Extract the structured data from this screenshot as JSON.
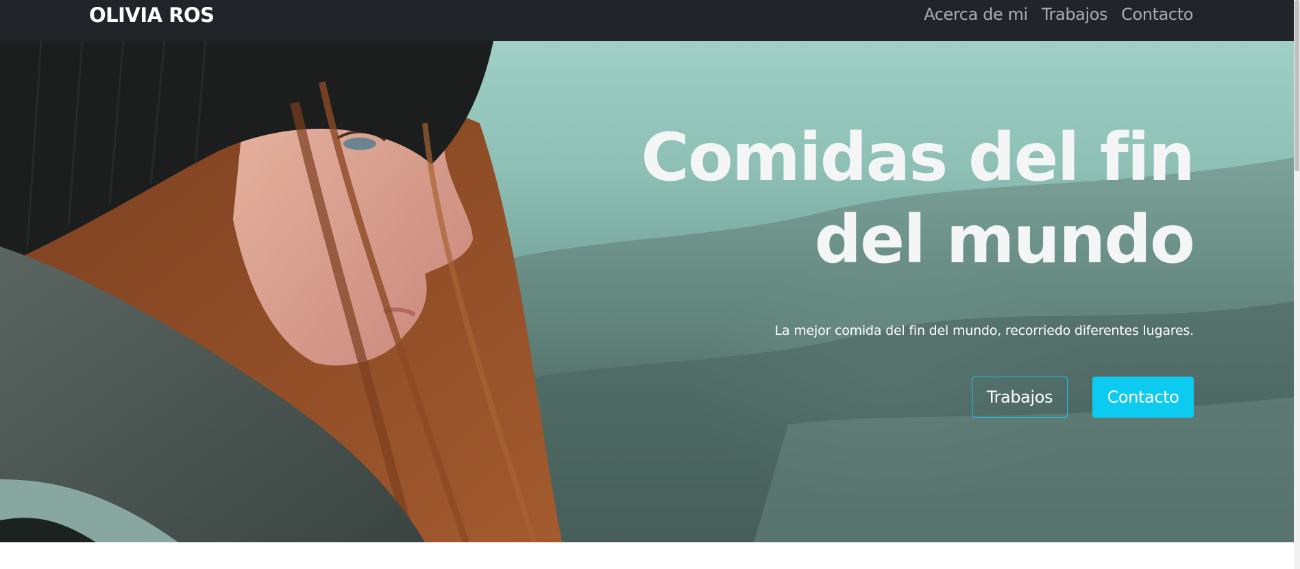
{
  "navbar": {
    "brand": "OLIVIA ROS",
    "links": [
      "Acerca de mi",
      "Trabajos",
      "Contacto"
    ]
  },
  "hero": {
    "title_line1": "Comidas del fin",
    "title_line2": "del mundo",
    "subtitle": "La mejor comida del fin del mundo, recorriedo diferentes lugares.",
    "button_outline": "Trabajos",
    "button_solid": "Contacto"
  },
  "colors": {
    "navbar_bg": "#212529",
    "accent": "#0dcaf0",
    "nav_link": "#a8acb0"
  }
}
